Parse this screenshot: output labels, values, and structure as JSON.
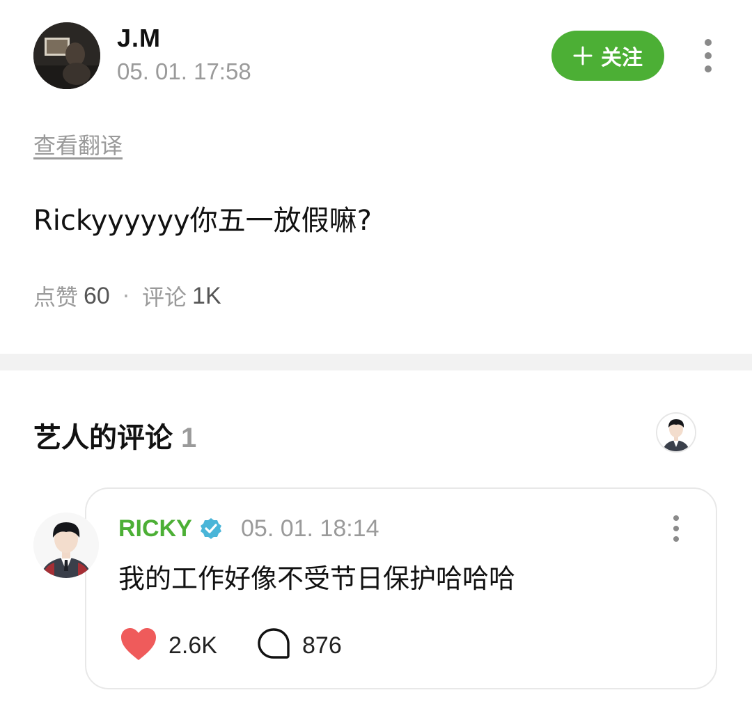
{
  "post": {
    "author": "J.M",
    "time": "05. 01. 17:58",
    "follow_label": "关注",
    "translate_label": "查看翻译",
    "body": "Rickyyyyyy你五一放假嘛?",
    "stats": {
      "likes_label": "点赞",
      "likes": "60",
      "separator": "·",
      "comments_label": "评论",
      "comments": "1K"
    }
  },
  "artist_section": {
    "title": "艺人的评论",
    "count": "1"
  },
  "comment": {
    "author": "RICKY",
    "verified": true,
    "time": "05. 01. 18:14",
    "text": "我的工作好像不受节日保护哈哈哈",
    "likes": "2.6K",
    "replies": "876"
  },
  "icons": {
    "follow": "plus-icon",
    "more": "more-vertical-icon",
    "verified": "verified-badge-icon",
    "like": "heart-icon",
    "reply": "comment-bubble-icon"
  },
  "colors": {
    "accent": "#4caf35",
    "heart": "#ef5b5b",
    "verified": "#4ab5d8",
    "muted": "#9a9a9a",
    "divider": "#f2f2f2"
  }
}
